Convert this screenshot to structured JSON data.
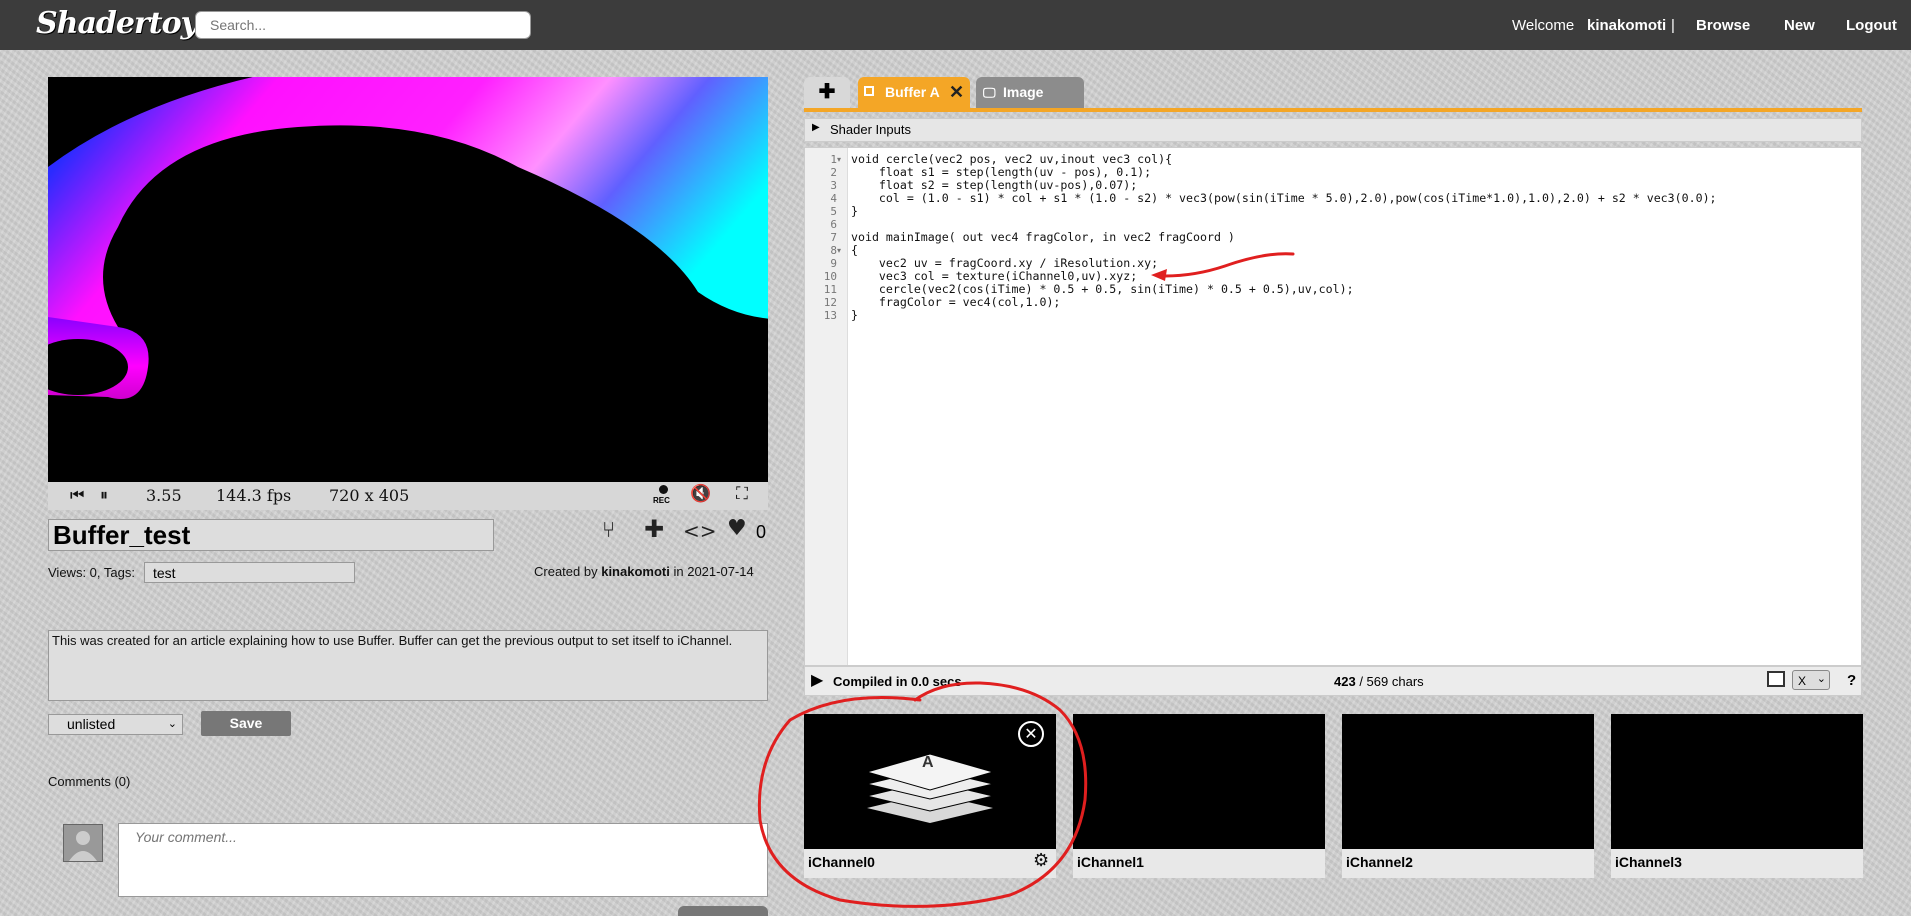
{
  "header": {
    "logo": "Shadertoy",
    "search_placeholder": "Search...",
    "welcome": "Welcome",
    "username": "kinakomoti",
    "separator": "|",
    "browse": "Browse",
    "new": "New",
    "logout": "Logout"
  },
  "player": {
    "time": "3.55",
    "fps": "144.3 fps",
    "resolution": "720 x 405",
    "rec": "REC"
  },
  "shader": {
    "title": "Buffer_test",
    "likes": "0",
    "views": "Views: 0, Tags:",
    "tags": "test",
    "created_by_prefix": "Created by",
    "author": "kinakomoti",
    "in": "in",
    "date": "2021-07-14",
    "description": "This was created for an article explaining how to use Buffer. Buffer can get the previous output to set itself to iChannel.",
    "visibility": "unlisted",
    "save": "Save"
  },
  "comments": {
    "header": "Comments (0)",
    "placeholder": "Your comment..."
  },
  "editor": {
    "tabs": [
      "Buffer A",
      "Image"
    ],
    "shader_inputs": "Shader Inputs",
    "lines": [
      "void cercle(vec2 pos, vec2 uv,inout vec3 col){",
      "    float s1 = step(length(uv - pos), 0.1);",
      "    float s2 = step(length(uv-pos),0.07);",
      "    col = (1.0 - s1) * col + s1 * (1.0 - s2) * vec3(pow(sin(iTime * 5.0),2.0),pow(cos(iTime*1.0),1.0),2.0) + s2 * vec3(0.0);",
      "}",
      "",
      "void mainImage( out vec4 fragColor, in vec2 fragCoord )",
      "{",
      "    vec2 uv = fragCoord.xy / iResolution.xy;",
      "    vec3 col = texture(iChannel0,uv).xyz;",
      "    cercle(vec2(cos(iTime) * 0.5 + 0.5, sin(iTime) * 0.5 + 0.5),uv,col);",
      "    fragColor = vec4(col,1.0);",
      "}"
    ],
    "line_numbers": [
      "1",
      "2",
      "3",
      "4",
      "5",
      "6",
      "7",
      "8",
      "9",
      "10",
      "11",
      "12",
      "13"
    ],
    "compiled": "Compiled in 0.0 secs",
    "chars_count": "423",
    "chars_total": "/ 569 chars",
    "mode": "X",
    "help": "?"
  },
  "channels": [
    {
      "label": "iChannel0",
      "content": "A"
    },
    {
      "label": "iChannel1"
    },
    {
      "label": "iChannel2"
    },
    {
      "label": "iChannel3"
    }
  ],
  "colors": {
    "accent": "#f4a626",
    "annotation": "#e01f1f"
  }
}
